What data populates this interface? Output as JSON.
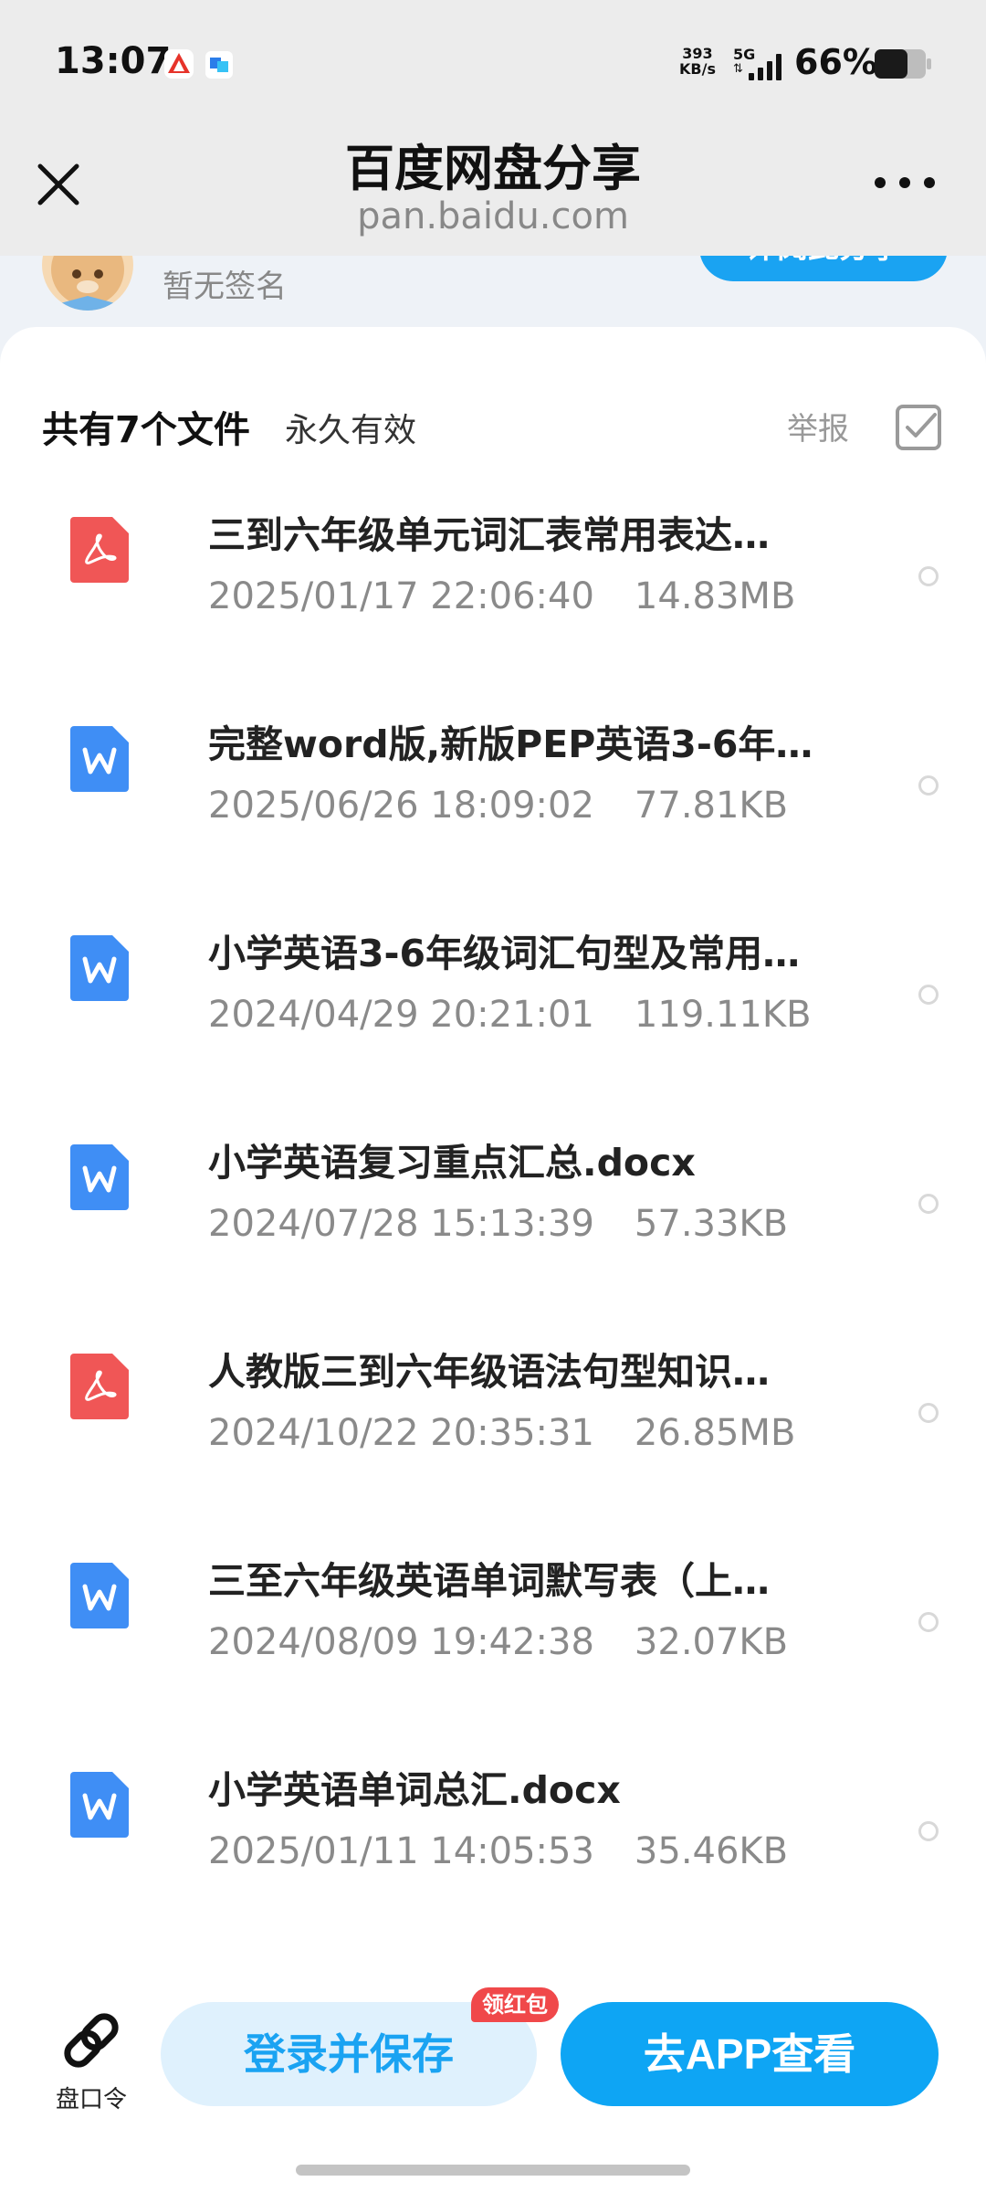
{
  "status_bar": {
    "time": "13:07",
    "net_speed_value": "393",
    "net_speed_unit": "KB/s",
    "network": "5G",
    "battery": "66%"
  },
  "nav": {
    "title": "百度网盘分享",
    "subtitle": "pan.baidu.com"
  },
  "user": {
    "signature": "暂无签名",
    "action_partial": "评阅此分享"
  },
  "share": {
    "file_count": "共有7个文件",
    "validity": "永久有效",
    "report": "举报"
  },
  "files": [
    {
      "type": "pdf",
      "name": "三到六年级单元词汇表常用表达…",
      "datetime": "2025/01/17 22:06:40",
      "size": "14.83MB"
    },
    {
      "type": "word",
      "name": "完整word版,新版PEP英语3-6年…",
      "datetime": "2025/06/26 18:09:02",
      "size": "77.81KB"
    },
    {
      "type": "word",
      "name": "小学英语3-6年级词汇句型及常用…",
      "datetime": "2024/04/29 20:21:01",
      "size": "119.11KB"
    },
    {
      "type": "word",
      "name": "小学英语复习重点汇总.docx",
      "datetime": "2024/07/28 15:13:39",
      "size": "57.33KB"
    },
    {
      "type": "pdf",
      "name": "人教版三到六年级语法句型知识…",
      "datetime": "2024/10/22 20:35:31",
      "size": "26.85MB"
    },
    {
      "type": "word",
      "name": "三至六年级英语单词默写表（上…",
      "datetime": "2024/08/09 19:42:38",
      "size": "32.07KB"
    },
    {
      "type": "word",
      "name": "小学英语单词总汇.docx",
      "datetime": "2025/01/11 14:05:53",
      "size": "35.46KB"
    }
  ],
  "bottom": {
    "link_label": "盘口令",
    "save_label": "登录并保存",
    "badge": "领红包",
    "app_label": "去APP查看"
  },
  "colors": {
    "accent": "#1aa3f2",
    "pdf_icon": "#f05656",
    "word_icon": "#3f8ef5",
    "badge": "#f0484a"
  }
}
